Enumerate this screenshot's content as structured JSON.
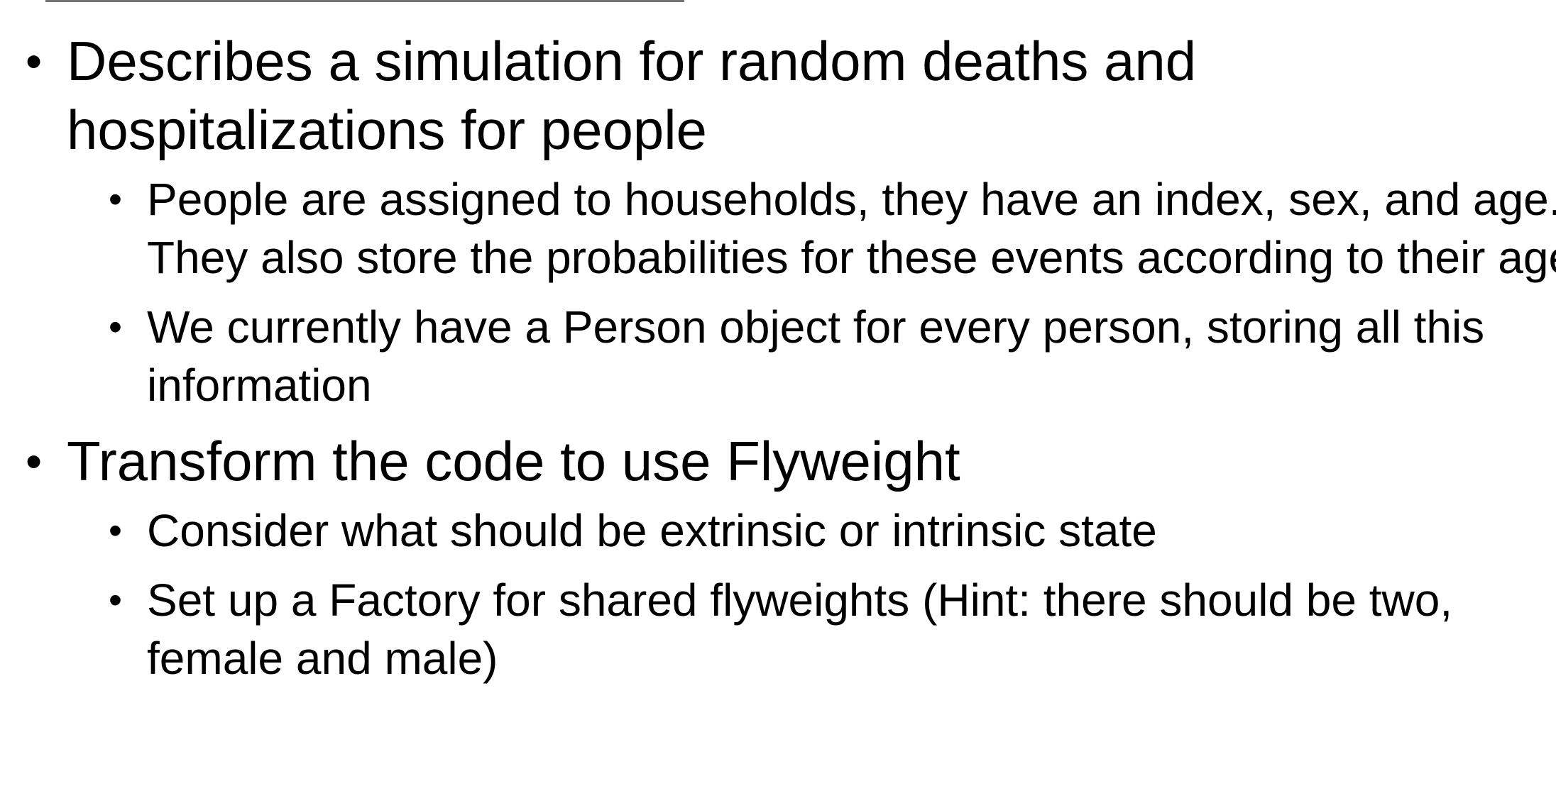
{
  "slide": {
    "bullets": [
      {
        "text": "Describes a simulation for random deaths and hospitalizations for people",
        "sub": [
          {
            "text": "People are assigned to households, they have an index, sex, and age. They also store the probabilities for these events according to their age"
          },
          {
            "text": "We currently have a Person object for every person, storing all this information"
          }
        ]
      },
      {
        "text": "Transform the code to use Flyweight",
        "sub": [
          {
            "text": "Consider what should be extrinsic or intrinsic state"
          },
          {
            "text": "Set up a Factory for shared flyweights (Hint: there should be two, female and male)"
          }
        ]
      }
    ]
  }
}
